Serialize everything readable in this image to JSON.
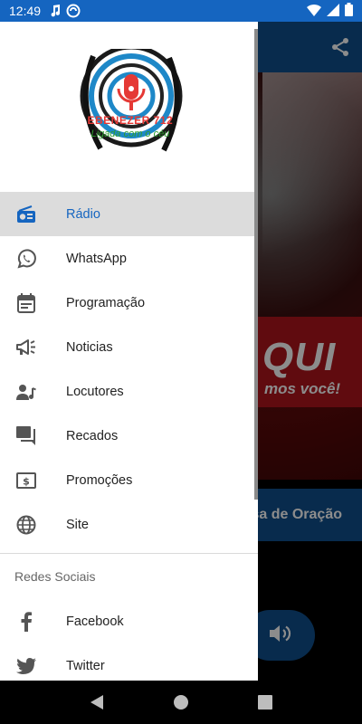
{
  "status_bar": {
    "time": "12:49"
  },
  "logo": {
    "line1": "EBENEZER 712",
    "line2": "Ligada com o céu"
  },
  "menu": [
    {
      "label": "Rádio",
      "icon": "radio-icon",
      "active": true
    },
    {
      "label": "WhatsApp",
      "icon": "whatsapp-icon"
    },
    {
      "label": "Programação",
      "icon": "calendar-icon"
    },
    {
      "label": "Noticias",
      "icon": "megaphone-icon"
    },
    {
      "label": "Locutores",
      "icon": "speaker-person-icon"
    },
    {
      "label": "Recados",
      "icon": "messages-icon"
    },
    {
      "label": "Promoções",
      "icon": "money-icon"
    },
    {
      "label": "Site",
      "icon": "globe-icon"
    }
  ],
  "social_section": {
    "title": "Redes Sociais"
  },
  "social": [
    {
      "label": "Facebook",
      "icon": "facebook-icon"
    },
    {
      "label": "Twitter",
      "icon": "twitter-icon"
    }
  ],
  "background": {
    "hero_big": "QUI",
    "hero_small": "mos você!",
    "program_title": "sa de Oração"
  },
  "colors": {
    "primary": "#104f8c",
    "status": "#1565c0",
    "active_text": "#1565c0",
    "active_bg": "#dcdcdc"
  }
}
